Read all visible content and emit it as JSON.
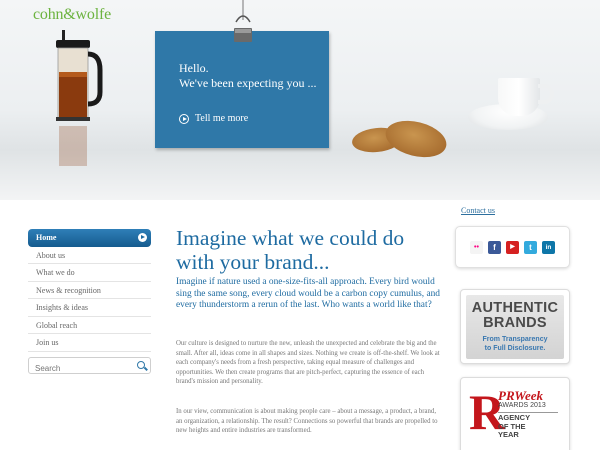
{
  "brand": {
    "logo_text": "cohn&wolfe"
  },
  "hero": {
    "greeting_line1": "Hello.",
    "greeting_line2": "We've been expecting you ...",
    "cta_label": "Tell me more"
  },
  "header": {
    "contact_label": "Contact us"
  },
  "nav": {
    "items": [
      {
        "label": "Home",
        "active": true
      },
      {
        "label": "About us"
      },
      {
        "label": "What we do"
      },
      {
        "label": "News & recognition"
      },
      {
        "label": "Insights & ideas"
      },
      {
        "label": "Global reach"
      },
      {
        "label": "Join us"
      }
    ]
  },
  "search": {
    "placeholder": "Search"
  },
  "main": {
    "headline": "Imagine what we could do with your brand...",
    "lede": "Imagine if nature used a one-size-fits-all approach. Every bird would sing the same song, every cloud would be a carbon copy cumulus, and every thunderstorm a rerun of the last. Who wants a world like that?",
    "para1": "Our culture is designed to nurture the new, unleash the unexpected and celebrate the big and the small. After all, ideas come in all shapes and sizes. Nothing we create is off-the-shelf. We look at each company's needs from a fresh perspective, taking equal measure of challenges and opportunities. We then create programs that are pitch-perfect, capturing the essence of each brand's mission and personality.",
    "para2": "In our view, communication is about making people care – about a message, a product, a brand, an organization, a relationship. The result? Connections so powerful that brands are propelled to new heights and entire industries are transformed."
  },
  "social": {
    "icons": [
      {
        "name": "flickr-icon",
        "glyph": "••",
        "color": "#ffffff"
      },
      {
        "name": "facebook-icon",
        "glyph": "f",
        "color": "#3b5998"
      },
      {
        "name": "youtube-icon",
        "glyph": "▶",
        "color": "#d52121"
      },
      {
        "name": "twitter-icon",
        "glyph": "t",
        "color": "#33aadd"
      },
      {
        "name": "linkedin-icon",
        "glyph": "in",
        "color": "#0e76a8"
      }
    ]
  },
  "badges": {
    "authentic_line1": "AUTHENTIC",
    "authentic_line2": "BRANDS",
    "authentic_tag1": "From Transparency",
    "authentic_tag2": "to Full Disclosure.",
    "prweek_r": "R",
    "prweek_title": "PRWeek",
    "prweek_awards": "AWARDS 2013",
    "prweek_agency1": "AGENCY",
    "prweek_agency2": "OF THE",
    "prweek_agency3": "YEAR"
  }
}
